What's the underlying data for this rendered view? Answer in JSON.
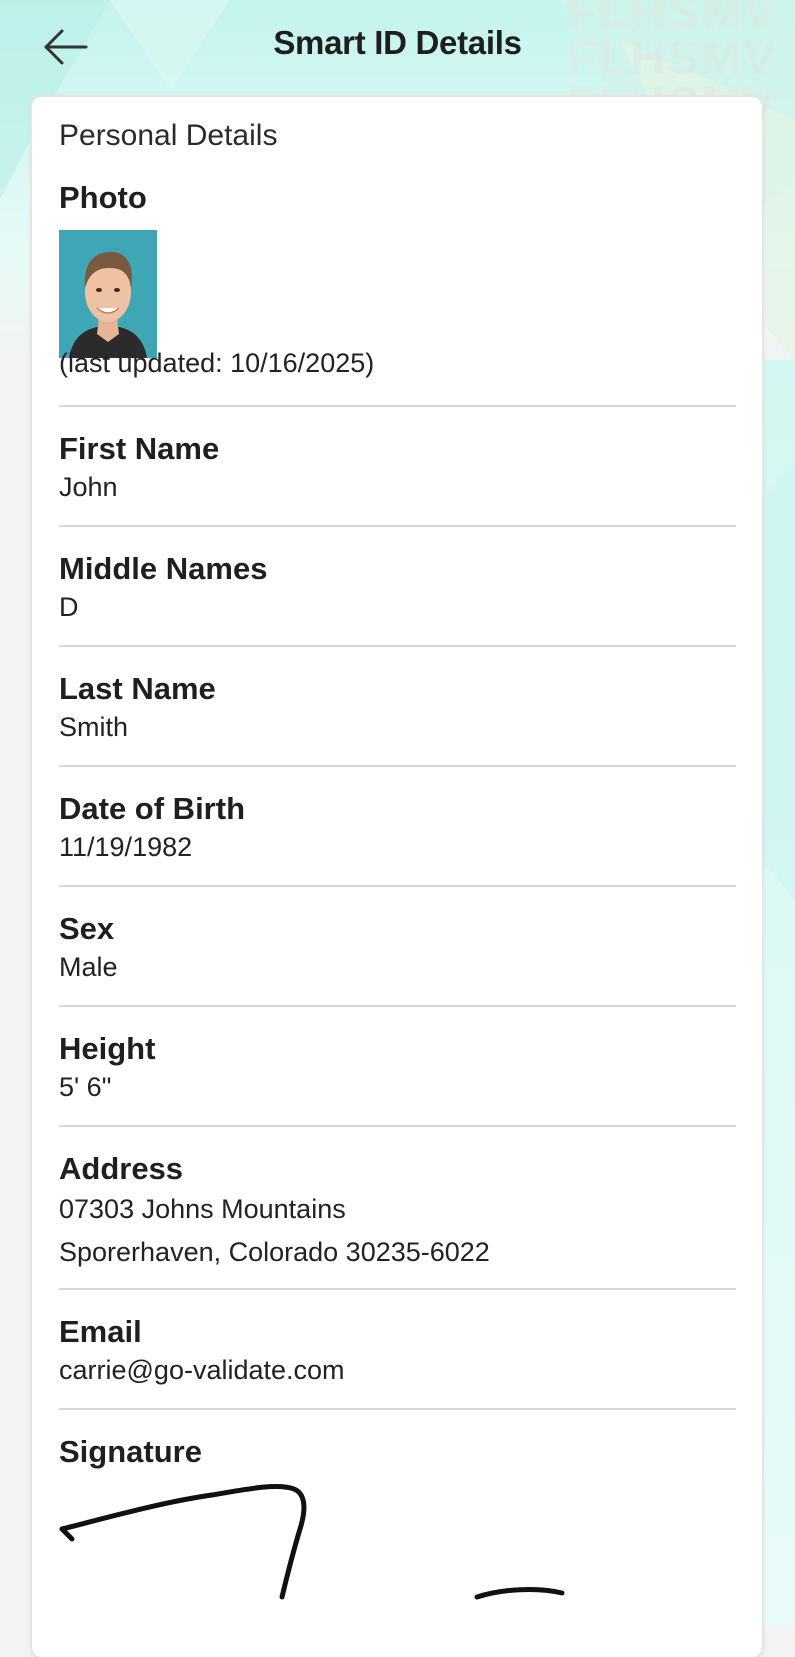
{
  "header": {
    "title": "Smart ID Details",
    "watermark_lines": [
      "FLHSMV",
      "FLHSMV",
      "FLHSMV"
    ]
  },
  "icons": {
    "back": "arrow-left-icon"
  },
  "colors": {
    "background_accent": "#c9f3ee",
    "card_background": "#ffffff",
    "divider": "#d6d6d6",
    "photo_background": "#3fa6b5"
  },
  "card": {
    "section_title": "Personal Details",
    "photo": {
      "label": "Photo",
      "last_updated": "(last updated: 10/16/2025)"
    },
    "fields": {
      "first_name": {
        "label": "First Name",
        "value": "John"
      },
      "middle_names": {
        "label": "Middle Names",
        "value": "D"
      },
      "last_name": {
        "label": "Last Name",
        "value": "Smith"
      },
      "dob": {
        "label": "Date of Birth",
        "value": "11/19/1982"
      },
      "sex": {
        "label": "Sex",
        "value": "Male"
      },
      "height": {
        "label": "Height",
        "value": "5' 6\""
      },
      "address": {
        "label": "Address",
        "line1": "07303 Johns Mountains",
        "line2": "Sporerhaven, Colorado 30235-6022"
      },
      "email": {
        "label": "Email",
        "value": "carrie@go-validate.com"
      },
      "signature": {
        "label": "Signature"
      }
    }
  }
}
